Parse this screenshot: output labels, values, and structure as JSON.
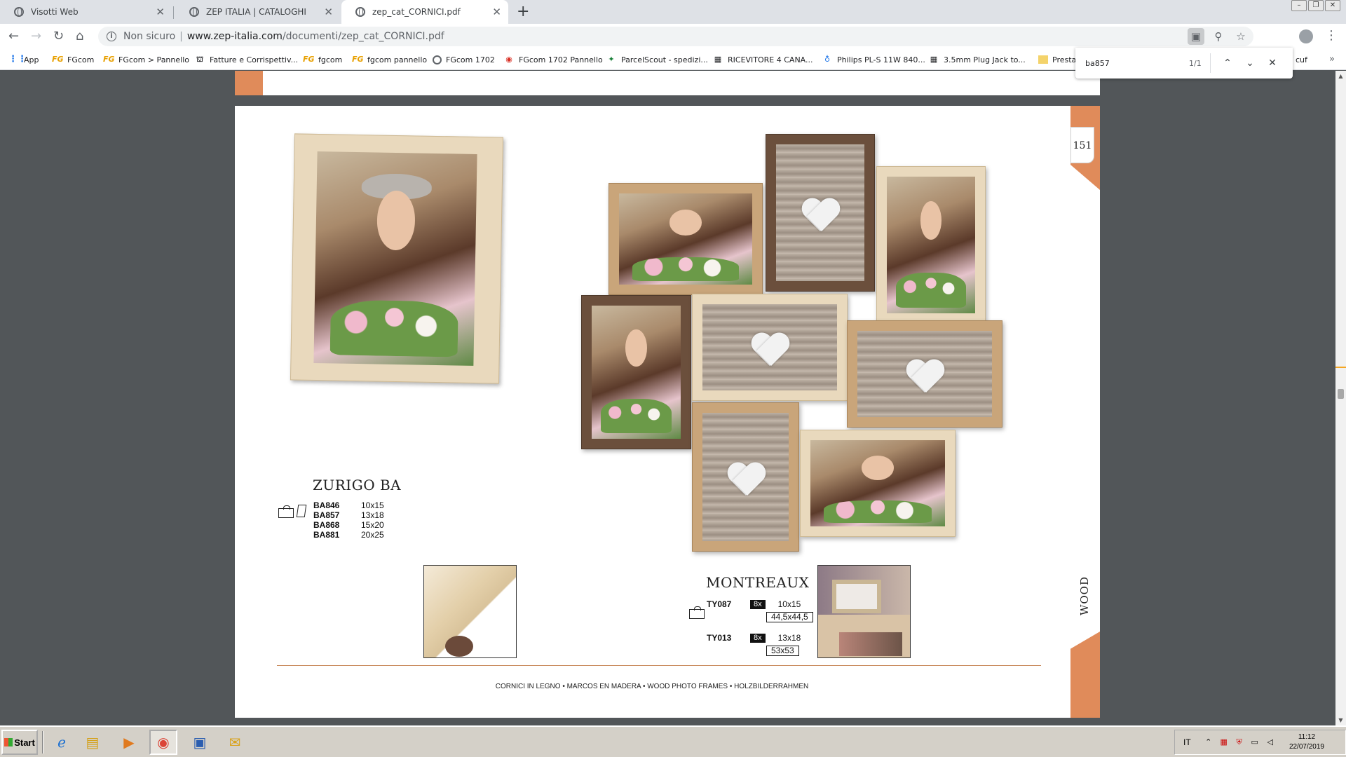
{
  "browser": {
    "tabs": [
      {
        "title": "Visotti Web",
        "active": false
      },
      {
        "title": "ZEP ITALIA | CATALOGHI",
        "active": false
      },
      {
        "title": "zep_cat_CORNICI.pdf",
        "active": true
      }
    ],
    "new_tab_glyph": "+",
    "address": {
      "security": "Non sicuro",
      "host": "www.zep-italia.com",
      "path": "/documenti/zep_cat_CORNICI.pdf"
    },
    "bookmarks": [
      {
        "label": "App",
        "icon": "apps-icon"
      },
      {
        "label": "FGcom",
        "icon": "fgcom-icon"
      },
      {
        "label": "FGcom > Pannello",
        "icon": "fgcom-icon"
      },
      {
        "label": "Fatture e Corrispettiv...",
        "icon": "tax-icon"
      },
      {
        "label": "fgcom",
        "icon": "fgcom-icon"
      },
      {
        "label": "fgcom pannello",
        "icon": "fgcom-icon"
      },
      {
        "label": "FGcom 1702",
        "icon": "globe-icon"
      },
      {
        "label": "FGcom 1702 Pannello",
        "icon": "globe-icon"
      },
      {
        "label": "ParcelScout - spedizi...",
        "icon": "parcel-icon"
      },
      {
        "label": "RICEVITORE 4 CANA...",
        "icon": "store-icon"
      },
      {
        "label": "Philips PL-S 11W 840...",
        "icon": "bulb-icon"
      },
      {
        "label": "3.5mm Plug Jack to...",
        "icon": "store-icon"
      },
      {
        "label": "Presta",
        "icon": "folder-icon"
      },
      {
        "label": "cuf",
        "icon": "folder-icon"
      }
    ],
    "find": {
      "query": "ba857",
      "count": "1/1"
    }
  },
  "pdf": {
    "page_number": "151",
    "side_label": "WOOD",
    "products": [
      {
        "name": "ZURIGO BA",
        "items": [
          {
            "code": "BA846",
            "size": "10x15"
          },
          {
            "code": "BA857",
            "size": "13x18"
          },
          {
            "code": "BA868",
            "size": "15x20"
          },
          {
            "code": "BA881",
            "size": "20x25"
          }
        ]
      },
      {
        "name": "MONTREAUX",
        "items": [
          {
            "code": "TY087",
            "qty": "8x",
            "size": "10x15",
            "overall": "44,5x44,5"
          },
          {
            "code": "TY013",
            "qty": "8x",
            "size": "13x18",
            "overall": "53x53"
          }
        ]
      }
    ],
    "footer": "CORNICI IN LEGNO • MARCOS EN MADERA • WOOD PHOTO FRAMES • HOLZBILDERRAHMEN"
  },
  "taskbar": {
    "start_label": "Start",
    "language": "IT",
    "time": "11:12",
    "date": "22/07/2019"
  },
  "colors": {
    "accent": "#e08b5a",
    "viewer_bg": "#525659"
  }
}
